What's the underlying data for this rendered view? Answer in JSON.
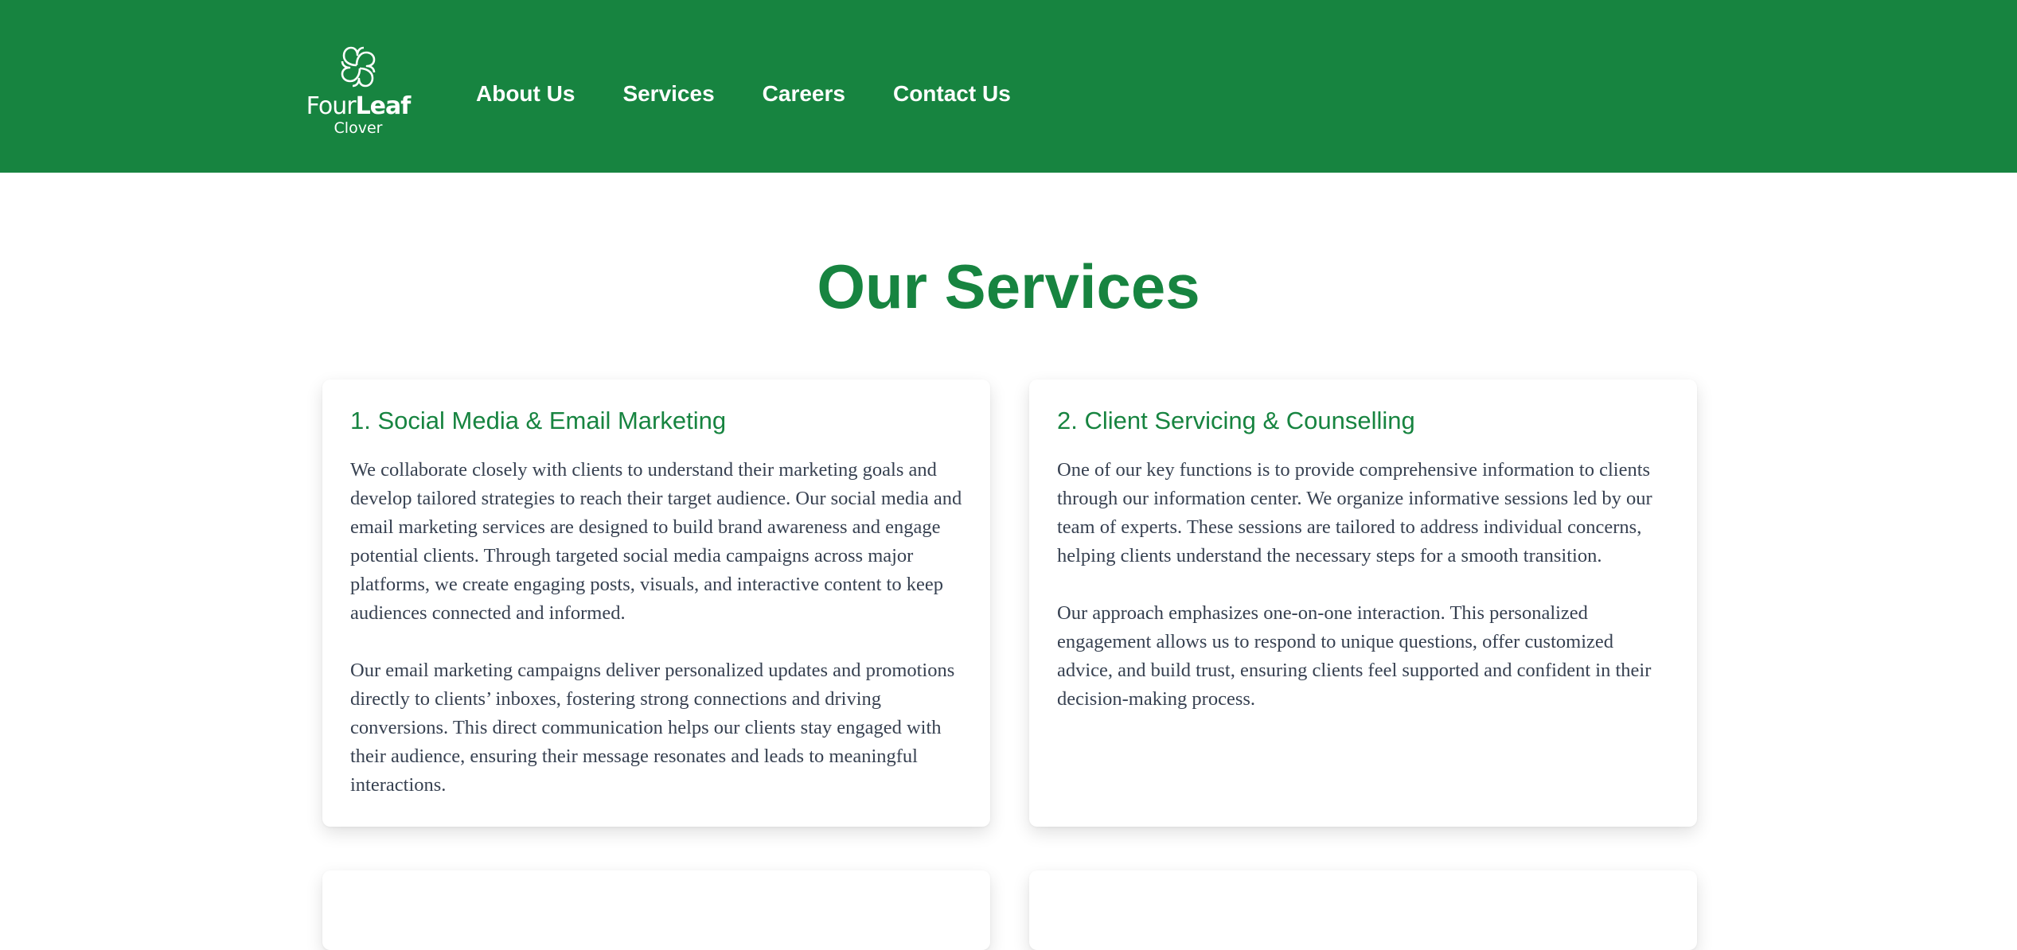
{
  "header": {
    "logo": {
      "line1_light": "Four",
      "line1_bold": "Leaf",
      "line2": "Clover",
      "icon": "four-leaf-clover-icon"
    },
    "nav": [
      {
        "label": "About Us"
      },
      {
        "label": "Services"
      },
      {
        "label": "Careers"
      },
      {
        "label": "Contact Us"
      }
    ]
  },
  "main": {
    "title": "Our Services",
    "services": [
      {
        "title": "1. Social Media & Email Marketing",
        "paragraphs": [
          "We collaborate closely with clients to understand their marketing goals and develop tailored strategies to reach their target audience. Our social media and email marketing services are designed to build brand awareness and engage potential clients. Through targeted social media campaigns across major platforms, we create engaging posts, visuals, and interactive content to keep audiences connected and informed.",
          "Our email marketing campaigns deliver personalized updates and promotions directly to clients’ inboxes, fostering strong connections and driving conversions. This direct communication helps our clients stay engaged with their audience, ensuring their message resonates and leads to meaningful interactions."
        ]
      },
      {
        "title": "2. Client Servicing & Counselling",
        "paragraphs": [
          "One of our key functions is to provide comprehensive information to clients through our information center. We organize informative sessions led by our team of experts. These sessions are tailored to address individual concerns, helping clients understand the necessary steps for a smooth transition.",
          "Our approach emphasizes one-on-one interaction. This personalized engagement allows us to respond to unique questions, offer customized advice, and build trust, ensuring clients feel supported and confident in their decision-making process."
        ]
      }
    ]
  },
  "colors": {
    "brand_green": "#178440",
    "body_text": "#374151",
    "background": "#ffffff"
  }
}
